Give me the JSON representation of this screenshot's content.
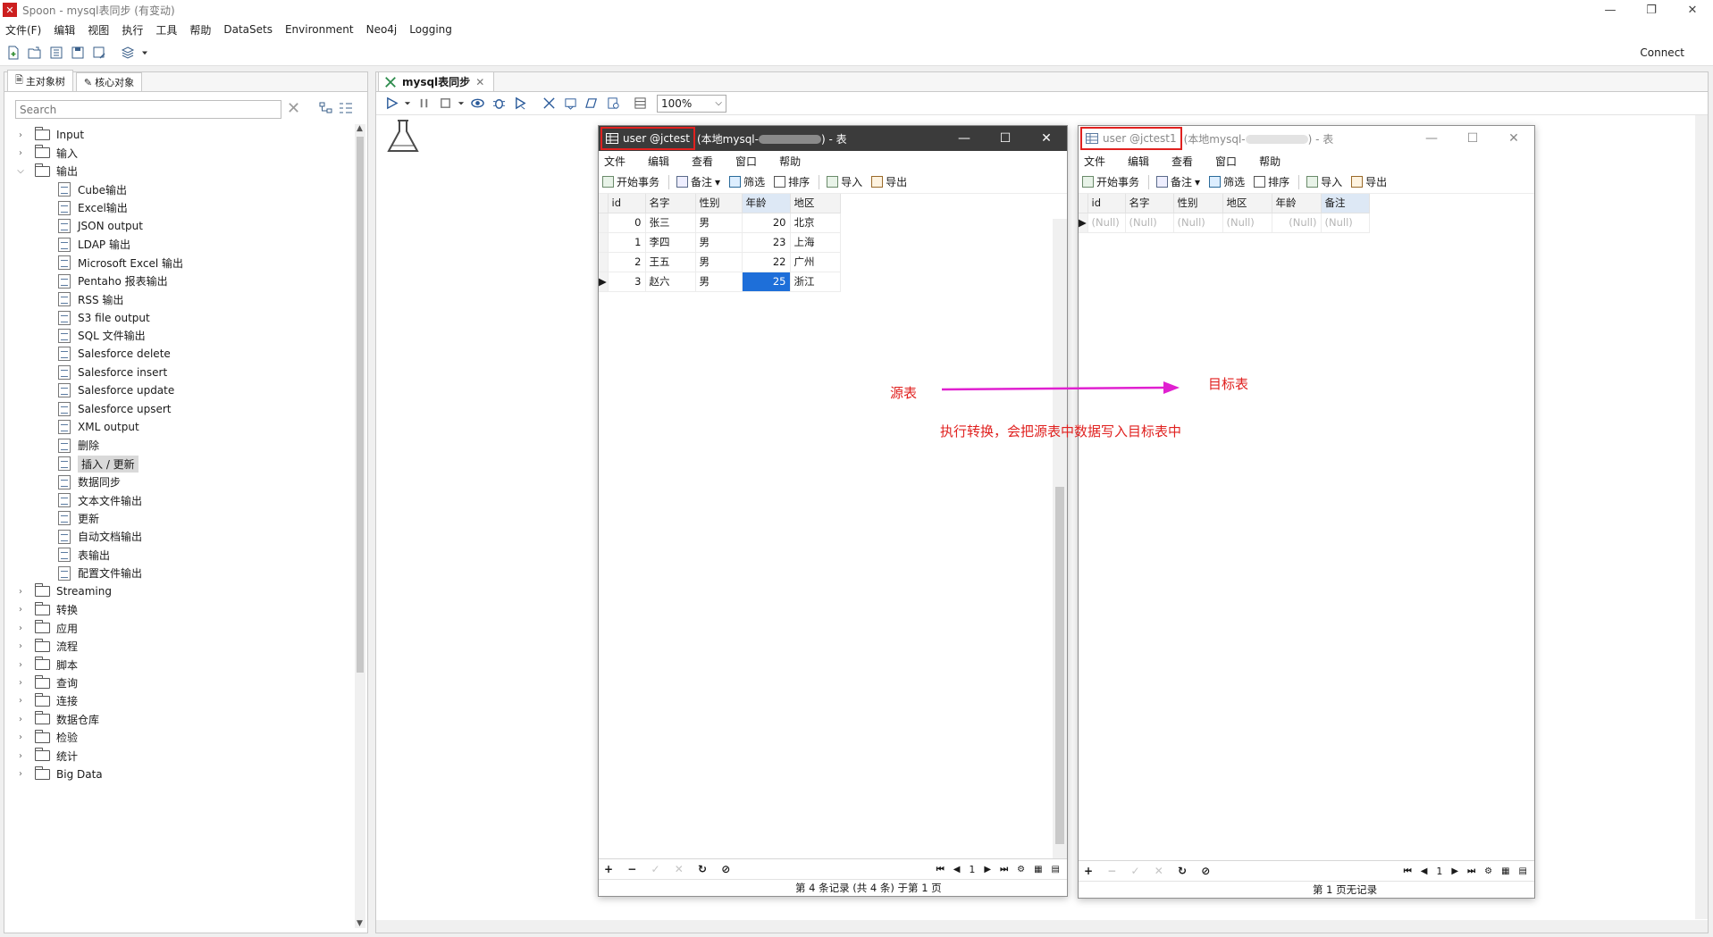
{
  "app": {
    "window_title": "Spoon - mysql表同步 (有变动)",
    "logo_letter": "✕"
  },
  "menu": [
    "文件(F)",
    "编辑",
    "视图",
    "执行",
    "工具",
    "帮助",
    "DataSets",
    "Environment",
    "Neo4j",
    "Logging"
  ],
  "toolbar": {
    "connect_label": "Connect"
  },
  "left_panel": {
    "tabs": [
      "主对象树",
      "核心对象"
    ],
    "search_placeholder": "Search",
    "tree": [
      {
        "label": "Input",
        "type": "folder",
        "expanded": false,
        "depth": 0
      },
      {
        "label": "输入",
        "type": "folder",
        "expanded": false,
        "depth": 0
      },
      {
        "label": "输出",
        "type": "folder",
        "expanded": true,
        "depth": 0
      },
      {
        "label": "Cube输出",
        "type": "item",
        "depth": 1
      },
      {
        "label": "Excel输出",
        "type": "item",
        "depth": 1
      },
      {
        "label": "JSON output",
        "type": "item",
        "depth": 1
      },
      {
        "label": "LDAP 输出",
        "type": "item",
        "depth": 1
      },
      {
        "label": "Microsoft Excel 输出",
        "type": "item",
        "depth": 1
      },
      {
        "label": "Pentaho 报表输出",
        "type": "item",
        "depth": 1
      },
      {
        "label": "RSS 输出",
        "type": "item",
        "depth": 1
      },
      {
        "label": "S3 file output",
        "type": "item",
        "depth": 1
      },
      {
        "label": "SQL 文件输出",
        "type": "item",
        "depth": 1
      },
      {
        "label": "Salesforce delete",
        "type": "item",
        "depth": 1
      },
      {
        "label": "Salesforce insert",
        "type": "item",
        "depth": 1
      },
      {
        "label": "Salesforce update",
        "type": "item",
        "depth": 1
      },
      {
        "label": "Salesforce upsert",
        "type": "item",
        "depth": 1
      },
      {
        "label": "XML output",
        "type": "item",
        "depth": 1
      },
      {
        "label": "删除",
        "type": "item",
        "depth": 1
      },
      {
        "label": "插入 / 更新",
        "type": "item",
        "depth": 1,
        "selected": true
      },
      {
        "label": "数据同步",
        "type": "item",
        "depth": 1
      },
      {
        "label": "文本文件输出",
        "type": "item",
        "depth": 1
      },
      {
        "label": "更新",
        "type": "item",
        "depth": 1
      },
      {
        "label": "自动文档输出",
        "type": "item",
        "depth": 1
      },
      {
        "label": "表输出",
        "type": "item",
        "depth": 1
      },
      {
        "label": "配置文件输出",
        "type": "item",
        "depth": 1
      },
      {
        "label": "Streaming",
        "type": "folder",
        "expanded": false,
        "depth": 0
      },
      {
        "label": "转换",
        "type": "folder",
        "expanded": false,
        "depth": 0
      },
      {
        "label": "应用",
        "type": "folder",
        "expanded": false,
        "depth": 0
      },
      {
        "label": "流程",
        "type": "folder",
        "expanded": false,
        "depth": 0
      },
      {
        "label": "脚本",
        "type": "folder",
        "expanded": false,
        "depth": 0
      },
      {
        "label": "查询",
        "type": "folder",
        "expanded": false,
        "depth": 0
      },
      {
        "label": "连接",
        "type": "folder",
        "expanded": false,
        "depth": 0
      },
      {
        "label": "数据仓库",
        "type": "folder",
        "expanded": false,
        "depth": 0
      },
      {
        "label": "检验",
        "type": "folder",
        "expanded": false,
        "depth": 0
      },
      {
        "label": "统计",
        "type": "folder",
        "expanded": false,
        "depth": 0
      },
      {
        "label": "Big Data",
        "type": "folder",
        "expanded": false,
        "depth": 0
      }
    ]
  },
  "editor": {
    "tab_label": "mysql表同步",
    "zoom": "100%"
  },
  "source_window": {
    "title_highlight": "user @jctest",
    "title_rest_prefix": "(本地mysql-",
    "title_rest_suffix": ") - 表",
    "menu": [
      "文件",
      "编辑",
      "查看",
      "窗口",
      "帮助"
    ],
    "toolbar": [
      "开始事务",
      "备注",
      "筛选",
      "排序",
      "导入",
      "导出"
    ],
    "columns": [
      "id",
      "名字",
      "性别",
      "年龄",
      "地区"
    ],
    "rows": [
      [
        "0",
        "张三",
        "男",
        "20",
        "北京"
      ],
      [
        "1",
        "李四",
        "男",
        "23",
        "上海"
      ],
      [
        "2",
        "王五",
        "男",
        "22",
        "广州"
      ],
      [
        "3",
        "赵六",
        "男",
        "25",
        "浙江"
      ]
    ],
    "page": "1",
    "status": "第 4 条记录 (共 4 条) 于第 1 页"
  },
  "target_window": {
    "title_highlight": "user @jctest1",
    "title_rest_prefix": "(本地mysql-",
    "title_rest_suffix": ") - 表",
    "menu": [
      "文件",
      "编辑",
      "查看",
      "窗口",
      "帮助"
    ],
    "toolbar": [
      "开始事务",
      "备注",
      "筛选",
      "排序",
      "导入",
      "导出"
    ],
    "columns": [
      "id",
      "名字",
      "性别",
      "地区",
      "年龄",
      "备注"
    ],
    "rows": [
      [
        "(Null)",
        "(Null)",
        "(Null)",
        "(Null)",
        "(Null)",
        "(Null)"
      ]
    ],
    "page": "1",
    "status": "第 1 页无记录"
  },
  "annotations": {
    "source_label": "源表",
    "target_label": "目标表",
    "description": "执行转换，会把源表中数据写入目标表中",
    "arrow_color": "#e020d0",
    "text_color": "#e0211f"
  }
}
